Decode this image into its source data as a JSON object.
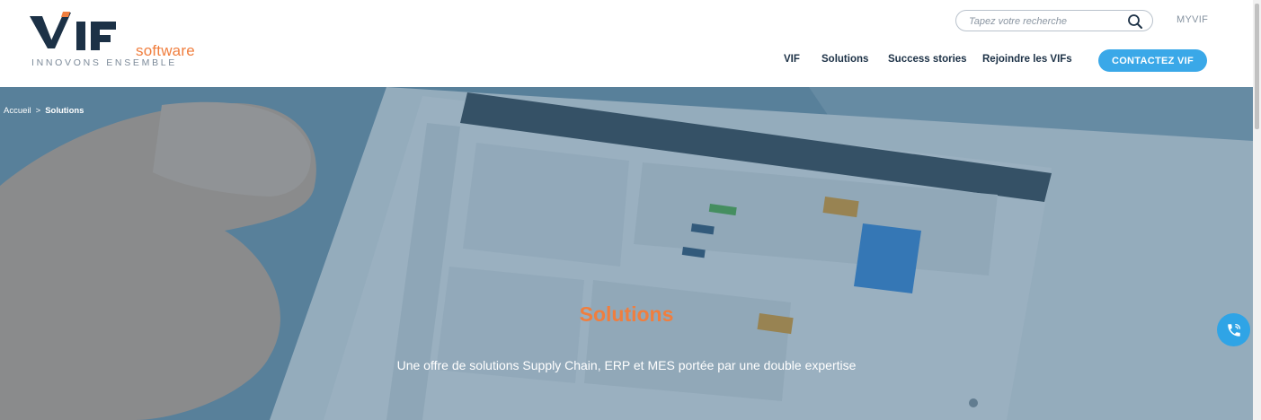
{
  "header": {
    "logo": {
      "brand": "VIF",
      "sub": "software",
      "tagline": "INNOVONS ENSEMBLE"
    },
    "search": {
      "placeholder": "Tapez votre recherche",
      "icon": "search-icon"
    },
    "myvif_label": "MYVIF",
    "nav": {
      "vif": "VIF",
      "solutions": "Solutions",
      "success_stories": "Success stories",
      "rejoindre": "Rejoindre les VIFs"
    },
    "cta_label": "CONTACTEZ VIF"
  },
  "hero": {
    "breadcrumb": {
      "home": "Accueil",
      "separator": ">",
      "current": "Solutions"
    },
    "title": "Solutions",
    "subtitle": "Une offre de solutions Supply Chain, ERP et MES portée par une double expertise",
    "phone_icon": "phone-icon"
  },
  "colors": {
    "brand_navy": "#1c3146",
    "accent_orange": "#f07e3e",
    "cta_blue": "#3aa8e8",
    "hero_overlay": "#2d5a7d"
  }
}
